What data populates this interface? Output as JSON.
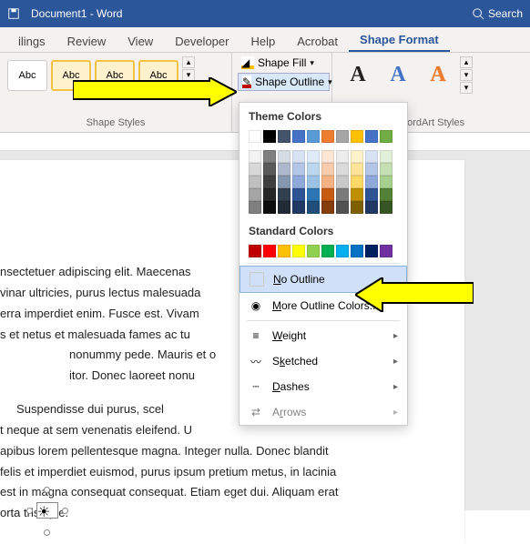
{
  "titlebar": {
    "doc_title": "Document1 - Word",
    "search": "Search"
  },
  "tabs": [
    "ilings",
    "Review",
    "View",
    "Developer",
    "Help",
    "Acrobat",
    "Shape Format"
  ],
  "active_tab": "Shape Format",
  "ribbon": {
    "shape_styles_label": "Shape Styles",
    "style_thumb_text": "Abc",
    "shape_fill": "Shape Fill",
    "shape_outline": "Shape Outline",
    "wordart_label": "WordArt Styles",
    "wordart_glyph": "A"
  },
  "dropdown": {
    "theme_colors": "Theme Colors",
    "standard_colors": "Standard Colors",
    "no_outline": "No Outline",
    "more_colors": "More Outline Colors...",
    "weight": "Weight",
    "sketched": "Sketched",
    "dashes": "Dashes",
    "arrows": "Arrows",
    "theme_row1": [
      "#FFFFFF",
      "#000000",
      "#44546A",
      "#4472C4",
      "#5B9BD5",
      "#ED7D31",
      "#A5A5A5",
      "#FFC000",
      "#4472C4",
      "#70AD47"
    ],
    "tints": [
      "#F2F2F2",
      "#7F7F7F",
      "#D6DCE4",
      "#D9E2F3",
      "#DEEBF6",
      "#FBE5D5",
      "#EDEDED",
      "#FFF2CC",
      "#D9E2F3",
      "#E2EFD9",
      "#D8D8D8",
      "#595959",
      "#ADB9CA",
      "#B4C6E7",
      "#BDD7EE",
      "#F7CBAC",
      "#DBDBDB",
      "#FEE599",
      "#B4C6E7",
      "#C5E0B3",
      "#BFBFBF",
      "#3F3F3F",
      "#8496B0",
      "#8EAADB",
      "#9CC3E5",
      "#F4B183",
      "#C9C9C9",
      "#FFD965",
      "#8EAADB",
      "#A8D08D",
      "#A5A5A5",
      "#262626",
      "#323F4F",
      "#2F5496",
      "#2E75B5",
      "#C55A11",
      "#7B7B7B",
      "#BF9000",
      "#2F5496",
      "#538135",
      "#7F7F7F",
      "#0C0C0C",
      "#222A35",
      "#1F3864",
      "#1E4E79",
      "#833C0B",
      "#525252",
      "#7F6000",
      "#1F3864",
      "#375623"
    ],
    "standard": [
      "#C00000",
      "#FF0000",
      "#FFC000",
      "#FFFF00",
      "#92D050",
      "#00B050",
      "#00B0F0",
      "#0070C0",
      "#002060",
      "#7030A0"
    ]
  },
  "document": {
    "p1": "nsectetuer adipiscing elit. Maecenas",
    "p2": "vinar ultricies, purus lectus malesuada",
    "p3": "erra imperdiet enim. Fusce est. Vivam",
    "p4": "s et netus et malesuada fames ac tu",
    "p5": "nonummy pede. Mauris et o",
    "p6": "itor. Donec laoreet nonu",
    "p7": "     Suspendisse dui purus, scel",
    "p8": "t neque at sem venenatis eleifend. U",
    "p9": "apibus lorem pellentesque magna. Integer nulla. Donec blandit",
    "p10": "felis et imperdiet euismod, purus ipsum pretium metus, in lacinia",
    "p11": "est in magna consequat consequat. Etiam eget dui. Aliquam erat",
    "p12": "orta tristique."
  }
}
